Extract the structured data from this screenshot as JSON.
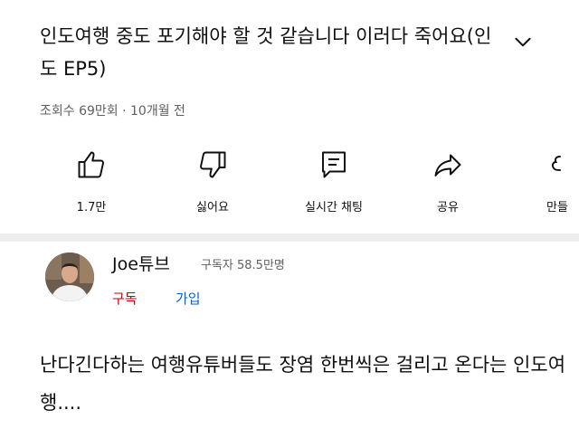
{
  "video": {
    "title": "인도여행 중도 포기해야 할 것 같습니다 이러다 죽어요(인도 EP5)",
    "meta": "조회수 69만회 · 10개월 전"
  },
  "actions": [
    {
      "label": "1.7만",
      "icon": "thumbs-up-icon"
    },
    {
      "label": "싫어요",
      "icon": "thumbs-down-icon"
    },
    {
      "label": "실시간 채팅",
      "icon": "live-chat-icon"
    },
    {
      "label": "공유",
      "icon": "share-icon"
    },
    {
      "label": "만들",
      "icon": "create-icon"
    }
  ],
  "channel": {
    "name": "Joe튜브",
    "subscribers": "구독자 58.5만명",
    "subscribe_label": "구독",
    "join_label": "가입"
  },
  "caption": "난다긴다하는 여행유튜버들도 장염 한번씩은 걸리고 온다는 인도여행....",
  "colors": {
    "subscribe": "#cc0000",
    "join": "#065fd4",
    "secondary_text": "#606060",
    "divider": "#eeeeee"
  }
}
